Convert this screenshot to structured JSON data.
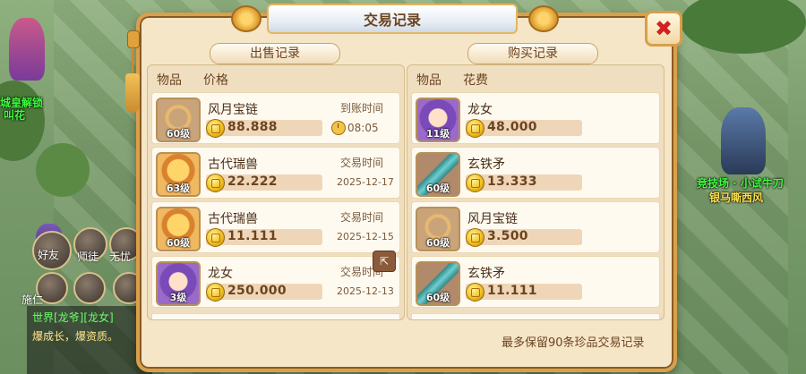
{
  "window": {
    "title": "交易记录"
  },
  "sell": {
    "tab_label": "出售记录",
    "col_item": "物品",
    "col_price": "价格",
    "rows": [
      {
        "name": "风月宝链",
        "level": "60级",
        "price": "88.888",
        "time_label": "到账时间",
        "time": "08:05",
        "icon": "bead-chain-icon"
      },
      {
        "name": "古代瑞兽",
        "level": "63级",
        "price": "22.222",
        "time_label": "交易时间",
        "time": "2025-12-17",
        "icon": "dragon-beast-icon"
      },
      {
        "name": "古代瑞兽",
        "level": "60级",
        "price": "11.111",
        "time_label": "交易时间",
        "time": "2025-12-15",
        "icon": "dragon-beast-icon"
      },
      {
        "name": "龙女",
        "level": "3级",
        "price": "250.000",
        "time_label": "交易时间",
        "time": "2025-12-13",
        "icon": "dragon-girl-icon"
      }
    ]
  },
  "buy": {
    "tab_label": "购买记录",
    "col_item": "物品",
    "col_cost": "花费",
    "rows": [
      {
        "name": "龙女",
        "level": "11级",
        "price": "48.000",
        "icon": "dragon-girl-icon"
      },
      {
        "name": "玄铁矛",
        "level": "60级",
        "price": "13.333",
        "icon": "iron-spear-icon"
      },
      {
        "name": "风月宝链",
        "level": "60级",
        "price": "3.500",
        "icon": "bead-chain-icon"
      },
      {
        "name": "玄铁矛",
        "level": "60级",
        "price": "11.111",
        "icon": "iron-spear-icon"
      }
    ]
  },
  "footer": {
    "note": "最多保留90条珍品交易记录"
  },
  "background": {
    "npc_left_1": "城皇解锁",
    "npc_left_2": "叫花",
    "npc_right_1": "竞技场 · 小试牛刀",
    "npc_right_2": "银马嘶西风",
    "left_ui": [
      "好友",
      "师徒",
      "无忧",
      "施仁"
    ],
    "chat_line_1": "世界[龙爷][龙女]",
    "chat_line_2": "爆成长，爆资质。"
  },
  "colors": {
    "accent": "#d99f4b",
    "coin": "#f2c021",
    "close": "#d42020"
  }
}
